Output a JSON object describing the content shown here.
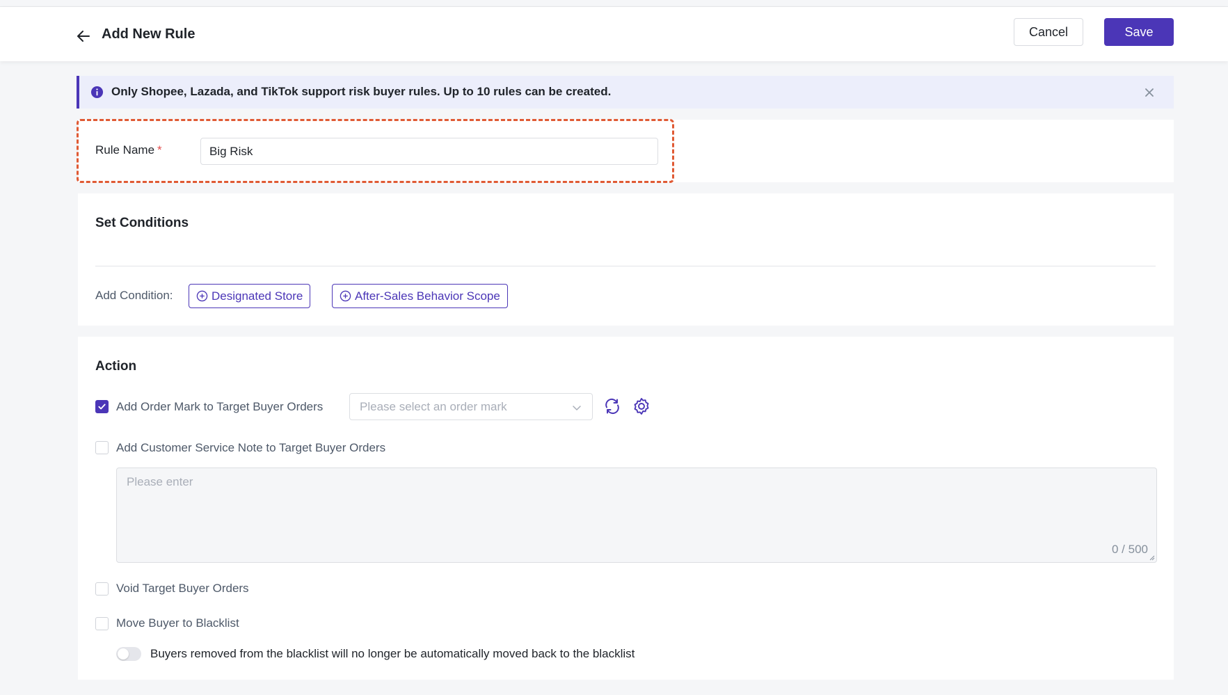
{
  "header": {
    "title": "Add New Rule",
    "cancel_label": "Cancel",
    "save_label": "Save"
  },
  "notice": {
    "text": "Only Shopee, Lazada, and TikTok support risk buyer rules. Up to 10 rules can be created."
  },
  "rule_name": {
    "label": "Rule Name",
    "required_mark": "*",
    "value": "Big Risk"
  },
  "conditions": {
    "title": "Set Conditions",
    "add_label": "Add Condition:",
    "buttons": [
      "Designated Store",
      "After-Sales Behavior Scope"
    ]
  },
  "action": {
    "title": "Action",
    "order_mark": {
      "label": "Add Order Mark to Target Buyer Orders",
      "checked": true,
      "placeholder": "Please select an order mark"
    },
    "service_note": {
      "label": "Add Customer Service Note to Target Buyer Orders",
      "checked": false,
      "placeholder": "Please enter",
      "counter": "0 / 500"
    },
    "void_orders": {
      "label": "Void Target Buyer Orders",
      "checked": false
    },
    "blacklist": {
      "label": "Move Buyer to Blacklist",
      "checked": false,
      "toggle_label": "Buyers removed from the blacklist will no longer be automatically moved back to the blacklist",
      "toggle_on": false
    }
  },
  "colors": {
    "accent": "#4b36b7",
    "highlight_dashed": "#e05a34",
    "required": "#e34d4d"
  }
}
